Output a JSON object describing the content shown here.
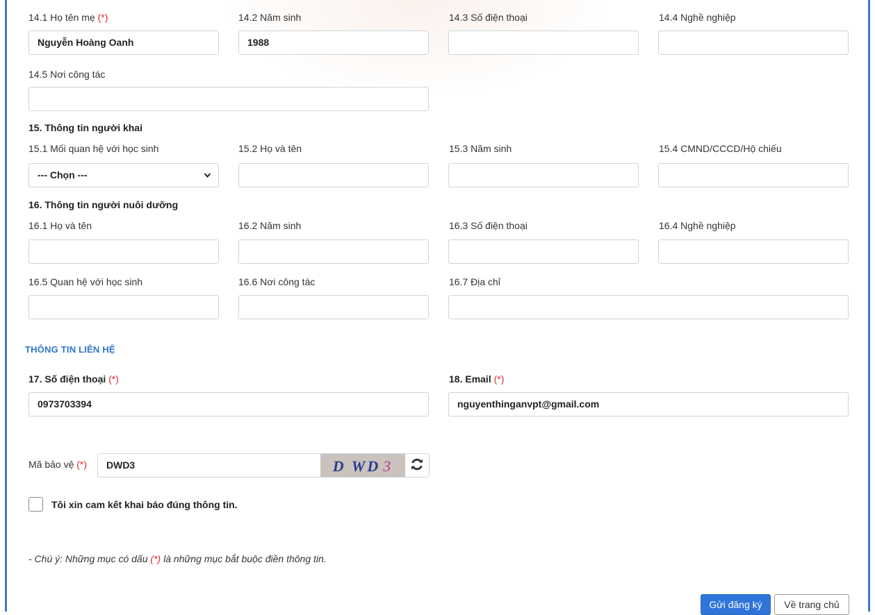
{
  "mother": {
    "name_label": "14.1 Họ tên mẹ",
    "name_value": "Nguyễn Hoàng Oanh",
    "birth_label": "14.2 Năm sinh",
    "birth_value": "1988",
    "phone_label": "14.3 Số điện thoại",
    "phone_value": "",
    "job_label": "14.4 Nghề nghiệp",
    "job_value": "",
    "workplace_label": "14.5 Nơi công tác",
    "workplace_value": ""
  },
  "declarant": {
    "title": "15. Thông tin người khai",
    "relation_label": "15.1 Mối quan hệ với học sinh",
    "relation_selected": "--- Chọn ---",
    "name_label": "15.2 Họ và tên",
    "name_value": "",
    "birth_label": "15.3 Năm sinh",
    "birth_value": "",
    "id_label": "15.4 CMND/CCCD/Hộ chiếu",
    "id_value": ""
  },
  "guardian": {
    "title": "16. Thông tin người nuôi dưỡng",
    "name_label": "16.1 Họ và tên",
    "name_value": "",
    "birth_label": "16.2 Năm sinh",
    "birth_value": "",
    "phone_label": "16.3 Số điện thoại",
    "phone_value": "",
    "job_label": "16.4 Nghề nghiệp",
    "job_value": "",
    "relation_label": "16.5 Quan hệ với học sinh",
    "relation_value": "",
    "workplace_label": "16.6 Nơi công tác",
    "workplace_value": "",
    "address_label": "16.7 Địa chỉ",
    "address_value": ""
  },
  "contact": {
    "title": "THÔNG TIN LIÊN HỆ",
    "phone_label": "17. Số điện thoại",
    "phone_value": "0973703394",
    "email_label": "18. Email",
    "email_value": "nguyenthinganvpt@gmail.com"
  },
  "captcha": {
    "label": "Mã bảo vệ",
    "value": "DWD3",
    "image_text": "D WD",
    "image_last": "3",
    "refresh_icon": "refresh-icon"
  },
  "required_mark": "(*)",
  "commit": {
    "label": "Tôi xin cam kết khai báo đúng thông tin.",
    "checked": false
  },
  "note": {
    "prefix": "- Chú ý: Những mục có dấu ",
    "suffix": " là những mục bắt buộc điền thông tin."
  },
  "buttons": {
    "submit": "Gửi đăng ký",
    "home": "Về trang chủ"
  },
  "colors": {
    "accent": "#2f74d9",
    "required": "#e0262b",
    "section_title": "#2e75c6"
  }
}
